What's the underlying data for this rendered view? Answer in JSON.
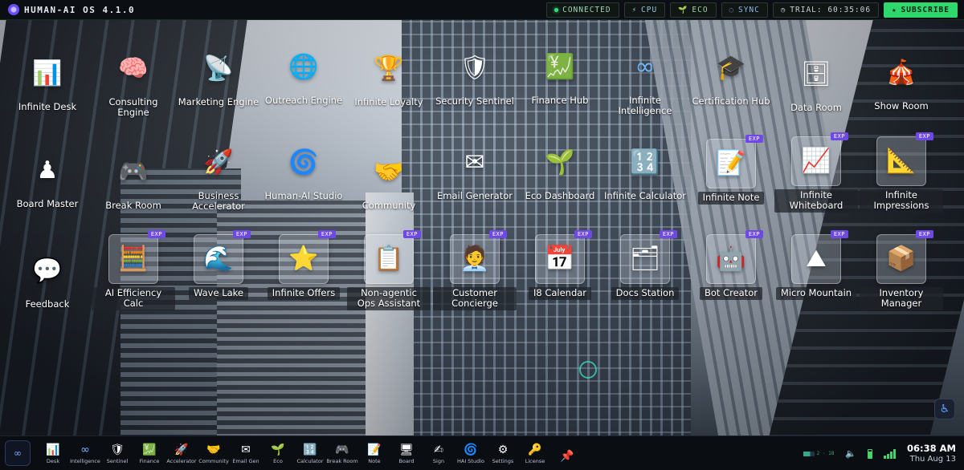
{
  "topbar": {
    "brand": "HUMAN-AI OS 4.1.0",
    "status": {
      "connected": "CONNECTED",
      "cpu": "CPU",
      "eco": "ECO",
      "sync": "SYNC",
      "trial": "TRIAL: 60:35:06",
      "subscribe": "SUBSCRIBE"
    }
  },
  "desktop": {
    "exp_badge": "EXP",
    "apps": [
      {
        "label": "Infinite Desk",
        "glyph": "📊"
      },
      {
        "label": "Consulting Engine",
        "glyph": "🧠"
      },
      {
        "label": "Marketing Engine",
        "glyph": "📡"
      },
      {
        "label": "Outreach Engine",
        "glyph": "🌐"
      },
      {
        "label": "Infinite Loyalty",
        "glyph": "🏆"
      },
      {
        "label": "Security Sentinel",
        "glyph": "🛡"
      },
      {
        "label": "Finance Hub",
        "glyph": "💹"
      },
      {
        "label": "Infinite Intelligence",
        "glyph": "∞"
      },
      {
        "label": "Certification Hub",
        "glyph": "🎓"
      },
      {
        "label": "Data Room",
        "glyph": "🗄"
      },
      {
        "label": "Show Room",
        "glyph": "🎪"
      },
      {
        "label": "Board Master",
        "glyph": "♟"
      },
      {
        "label": "Break Room",
        "glyph": "🎮"
      },
      {
        "label": "Business Accelerator",
        "glyph": "🚀"
      },
      {
        "label": "Human-AI Studio",
        "glyph": "🌀"
      },
      {
        "label": "Community",
        "glyph": "🤝"
      },
      {
        "label": "Email Generator",
        "glyph": "✉"
      },
      {
        "label": "Eco Dashboard",
        "glyph": "🌱"
      },
      {
        "label": "Infinite Calculator",
        "glyph": "🔢"
      },
      {
        "label": "Infinite Note",
        "glyph": "📝"
      },
      {
        "label": "Infinite Whiteboard",
        "glyph": "📈"
      },
      {
        "label": "Infinite Impressions",
        "glyph": "📐"
      },
      {
        "label": "Feedback",
        "glyph": "💬"
      },
      {
        "label": "AI Efficiency Calc",
        "glyph": "🧮"
      },
      {
        "label": "Wave Lake",
        "glyph": "🌊"
      },
      {
        "label": "Infinite Offers",
        "glyph": "⭐"
      },
      {
        "label": "Non-agentic Ops Assistant",
        "glyph": "📋"
      },
      {
        "label": "Customer Concierge",
        "glyph": "🧑‍💼"
      },
      {
        "label": "I8 Calendar",
        "glyph": "📅"
      },
      {
        "label": "Docs Station",
        "glyph": "🗂"
      },
      {
        "label": "Bot Creator",
        "glyph": "🤖"
      },
      {
        "label": "Micro Mountain",
        "glyph": "⛰"
      },
      {
        "label": "Inventory Manager",
        "glyph": "📦"
      }
    ]
  },
  "taskbar": {
    "start_glyph": "∞",
    "dock": [
      {
        "label": "Desk",
        "glyph": "📊"
      },
      {
        "label": "Intelligence",
        "glyph": "∞"
      },
      {
        "label": "Sentinel",
        "glyph": "🛡"
      },
      {
        "label": "Finance",
        "glyph": "💹"
      },
      {
        "label": "Accelerator",
        "glyph": "🚀"
      },
      {
        "label": "Community",
        "glyph": "🤝"
      },
      {
        "label": "Email Gen",
        "glyph": "✉"
      },
      {
        "label": "Eco",
        "glyph": "🌱"
      },
      {
        "label": "Calculator",
        "glyph": "🔢"
      },
      {
        "label": "Break Room",
        "glyph": "🎮"
      },
      {
        "label": "Note",
        "glyph": "📝"
      },
      {
        "label": "Board",
        "glyph": "🖥"
      },
      {
        "label": "Sign",
        "glyph": "✍"
      },
      {
        "label": "HAI Studio",
        "glyph": "🌀"
      },
      {
        "label": "Settings",
        "glyph": "⚙"
      },
      {
        "label": "License",
        "glyph": "🔑"
      },
      {
        "label": "",
        "glyph": "📌"
      }
    ],
    "tray": {
      "net": "2 · 18",
      "time": "06:38 AM",
      "date": "Thu Aug 13"
    }
  }
}
